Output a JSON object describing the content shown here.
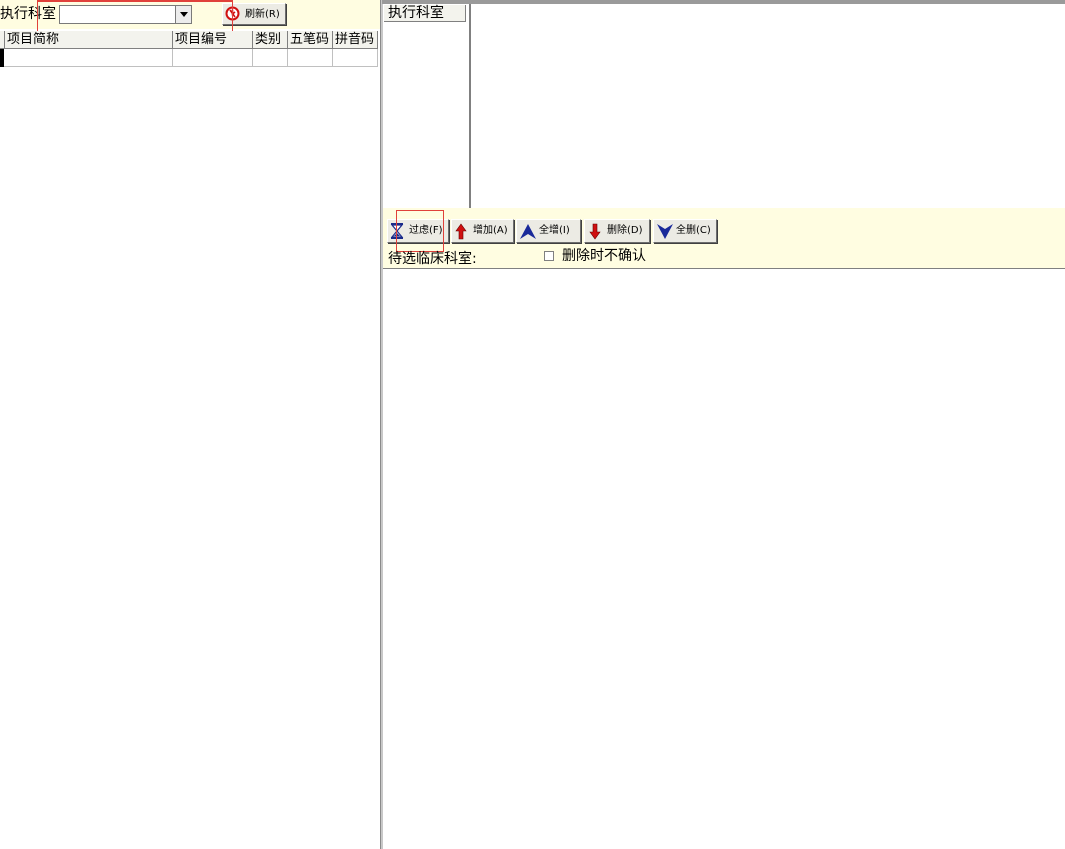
{
  "left_toolbar": {
    "dept_label": "执行科室",
    "dept_value": "",
    "refresh_label": "刷新(R)"
  },
  "grid": {
    "columns": [
      "项目简称",
      "项目编号",
      "类别",
      "五笔码",
      "拼音码"
    ]
  },
  "right": {
    "dept_list_header": "执行科室"
  },
  "right_toolbar": {
    "filter_label": "过虑(F)",
    "add_label": "增加(A)",
    "add_all_label": "全增(I)",
    "delete_label": "删除(D)",
    "delete_all_label": "全删(C)",
    "pending_label": "待选临床科室:",
    "no_confirm_label": "删除时不确认",
    "no_confirm_checked": false
  },
  "colors": {
    "toolbar_bg": "#fffde1",
    "highlight_box": "#e0413b"
  }
}
